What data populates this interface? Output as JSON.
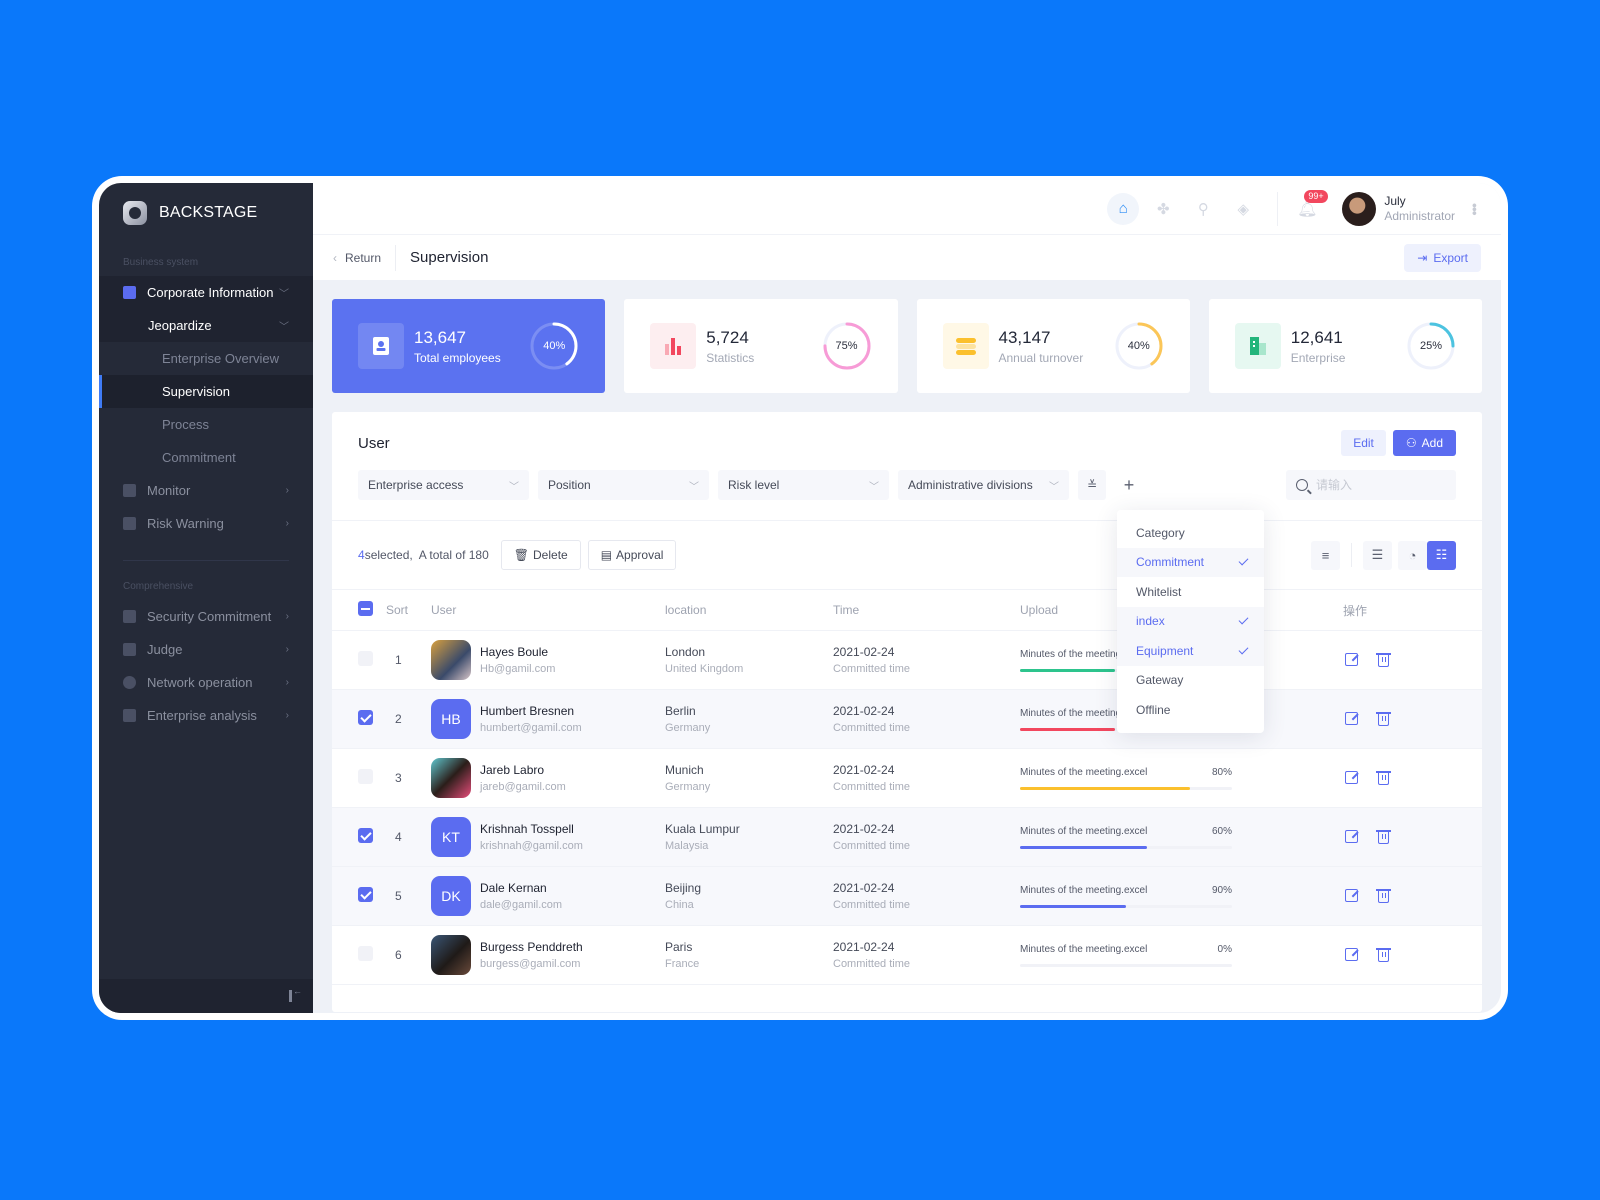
{
  "brand": {
    "name": "BACKSTAGE"
  },
  "sidebar": {
    "section1": "Business system",
    "corporate": "Corporate Information",
    "jeopardize": "Jeopardize",
    "leaves": [
      "Enterprise Overview",
      "Supervision",
      "Process",
      "Commitment"
    ],
    "active_leaf": "Supervision",
    "monitor": "Monitor",
    "risk": "Risk Warning",
    "section2": "Comprehensive",
    "items2": [
      "Security Commitment",
      "Judge",
      "Network operation",
      "Enterprise analysis"
    ]
  },
  "topbar": {
    "icons": [
      "home-icon",
      "apps-icon",
      "location-icon",
      "box-icon"
    ],
    "badge": "99+",
    "user_name": "July",
    "user_role": "Administrator"
  },
  "pagebar": {
    "return": "Return",
    "title": "Supervision",
    "export": "Export"
  },
  "cards": [
    {
      "value": "13,647",
      "label": "Total employees",
      "percent": 40,
      "pct_label": "40%",
      "color": "#ffffff"
    },
    {
      "value": "5,724",
      "label": "Statistics",
      "percent": 75,
      "pct_label": "75%",
      "color": "#f79bd6"
    },
    {
      "value": "43,147",
      "label": "Annual turnover",
      "percent": 40,
      "pct_label": "40%",
      "color": "#fbc658"
    },
    {
      "value": "12,641",
      "label": "Enterprise",
      "percent": 25,
      "pct_label": "25%",
      "color": "#4cc3e0"
    }
  ],
  "panel": {
    "title": "User",
    "edit": "Edit",
    "add": "Add",
    "filters": [
      "Enterprise access",
      "Position",
      "Risk level",
      "Administrative divisions"
    ],
    "search_placeholder": "请输入",
    "selected_count": "4",
    "selected_suffix": " selected,",
    "total": "A total of 180",
    "delete": "Delete",
    "approval": "Approval"
  },
  "dropdown": [
    {
      "label": "Category",
      "checked": false
    },
    {
      "label": "Commitment",
      "checked": true
    },
    {
      "label": "Whitelist",
      "checked": false
    },
    {
      "label": "index",
      "checked": true
    },
    {
      "label": "Equipment",
      "checked": true
    },
    {
      "label": "Gateway",
      "checked": false
    },
    {
      "label": "Offline",
      "checked": false
    }
  ],
  "table": {
    "headers": {
      "sort": "Sort",
      "user": "User",
      "location": "location",
      "time": "Time",
      "upload": "Upload",
      "ops": "操作"
    },
    "rows": [
      {
        "sort": "1",
        "name": "Hayes Boule",
        "email": "Hb@gamil.com",
        "city": "London",
        "country": "United Kingdom",
        "date": "2021-02-24",
        "date_sub": "Committed time",
        "file": "Minutes of the meeting.excel",
        "pct_label": "",
        "progress": 0.45,
        "bar": "#2dc48d",
        "checked": false,
        "initials": "",
        "photo": "p1"
      },
      {
        "sort": "2",
        "name": "Humbert Bresnen",
        "email": "humbert@gamil.com",
        "city": "Berlin",
        "country": "Germany",
        "date": "2021-02-24",
        "date_sub": "Committed time",
        "file": "Minutes of the meeting.excel",
        "pct_label": "",
        "progress": 0.45,
        "bar": "#f2475e",
        "checked": true,
        "initials": "HB",
        "photo": ""
      },
      {
        "sort": "3",
        "name": "Jareb Labro",
        "email": "jareb@gamil.com",
        "city": "Munich",
        "country": "Germany",
        "date": "2021-02-24",
        "date_sub": "Committed time",
        "file": "Minutes of the meeting.excel",
        "pct_label": "80%",
        "progress": 0.8,
        "bar": "#fbc02d",
        "checked": false,
        "initials": "",
        "photo": "p3"
      },
      {
        "sort": "4",
        "name": "Krishnah Tosspell",
        "email": "krishnah@gamil.com",
        "city": "Kuala Lumpur",
        "country": "Malaysia",
        "date": "2021-02-24",
        "date_sub": "Committed time",
        "file": "Minutes of the meeting.excel",
        "pct_label": "60%",
        "progress": 0.6,
        "bar": "#5b6cf0",
        "checked": true,
        "initials": "KT",
        "photo": ""
      },
      {
        "sort": "5",
        "name": "Dale Kernan",
        "email": "dale@gamil.com",
        "city": "Beijing",
        "country": "China",
        "date": "2021-02-24",
        "date_sub": "Committed time",
        "file": "Minutes of the meeting.excel",
        "pct_label": "90%",
        "progress": 0.5,
        "bar": "#5b6cf0",
        "checked": true,
        "initials": "DK",
        "photo": ""
      },
      {
        "sort": "6",
        "name": "Burgess Penddreth",
        "email": "burgess@gamil.com",
        "city": "Paris",
        "country": "France",
        "date": "2021-02-24",
        "date_sub": "Committed time",
        "file": "Minutes of the meeting.excel",
        "pct_label": "0%",
        "progress": 0,
        "bar": "#5b6cf0",
        "checked": false,
        "initials": "",
        "photo": "p6"
      }
    ]
  }
}
